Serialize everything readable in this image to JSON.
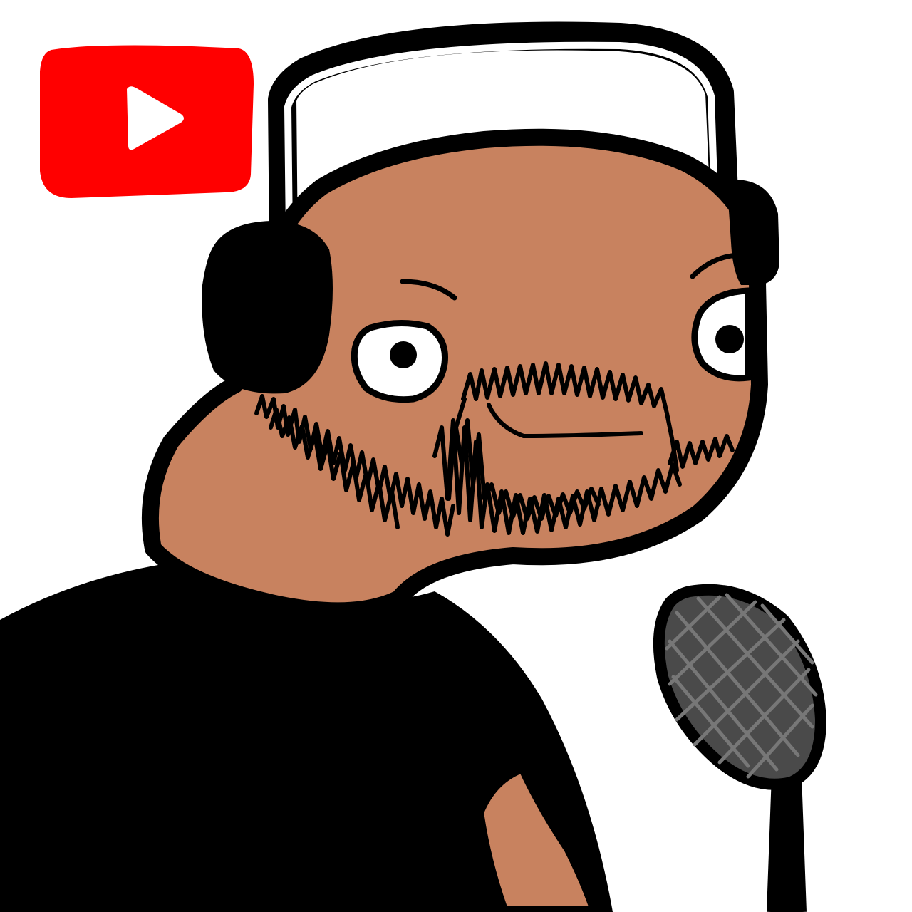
{
  "illustration": {
    "subject": "podcaster-avatar",
    "elements": [
      "youtube-logo",
      "headphones",
      "face",
      "beard",
      "t-shirt",
      "arm",
      "microphone"
    ]
  },
  "colors": {
    "background": "#ffffff",
    "youtube_red": "#ff0000",
    "play_white": "#ffffff",
    "skin": "#c8825f",
    "outline": "#000000",
    "shirt": "#000000",
    "mic_head": "#4a4a4a",
    "mic_mesh": "#777777",
    "eye_white": "#ffffff"
  },
  "icons": {
    "logo": "youtube-play-icon",
    "mic": "microphone-icon",
    "headphones": "headphones-icon"
  }
}
